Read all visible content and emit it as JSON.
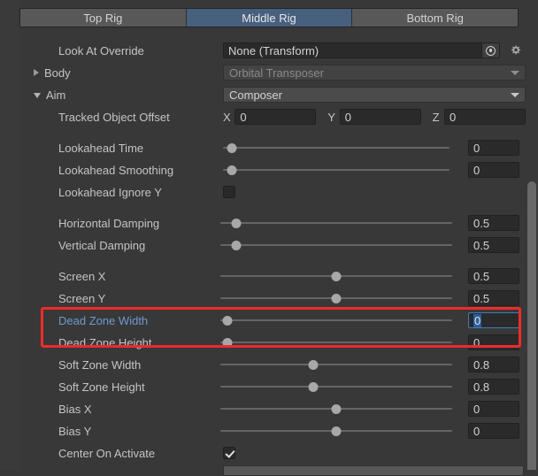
{
  "tabs": [
    {
      "label": "Top Rig",
      "active": false
    },
    {
      "label": "Middle Rig",
      "active": true
    },
    {
      "label": "Bottom Rig",
      "active": false
    }
  ],
  "accent_selected_tab": "#46607e",
  "accent_focus_label": "#6e9ad0",
  "accent_highlight_box": "#ee2b2b",
  "rows": {
    "look_at_override": {
      "label": "Look At Override",
      "value": "None (Transform)",
      "picker_icon": "object-picker-icon",
      "gear_icon": "gear-icon"
    },
    "body": {
      "label": "Body",
      "foldout": "collapsed",
      "value": "Orbital Transposer"
    },
    "aim": {
      "label": "Aim",
      "foldout": "expanded",
      "value": "Composer"
    },
    "tracked_object_offset": {
      "label": "Tracked Object Offset",
      "x_label": "X",
      "x_value": "0",
      "y_label": "Y",
      "y_value": "0",
      "z_label": "Z",
      "z_value": "0"
    },
    "lookahead_time": {
      "label": "Lookahead Time",
      "value": "0",
      "knob_pct": 0
    },
    "lookahead_smoothing": {
      "label": "Lookahead Smoothing",
      "value": "0",
      "knob_pct": 0
    },
    "lookahead_ignore_y": {
      "label": "Lookahead Ignore Y",
      "checked": false
    },
    "horizontal_damping": {
      "label": "Horizontal Damping",
      "value": "0.5",
      "knob_pct": 3
    },
    "vertical_damping": {
      "label": "Vertical Damping",
      "value": "0.5",
      "knob_pct": 3
    },
    "screen_x": {
      "label": "Screen X",
      "value": "0.5",
      "knob_pct": 50
    },
    "screen_y": {
      "label": "Screen Y",
      "value": "0.5",
      "knob_pct": 50
    },
    "dead_zone_width": {
      "label": "Dead Zone Width",
      "value": "0",
      "knob_pct": 0,
      "focused": true
    },
    "dead_zone_height": {
      "label": "Dead Zone Height",
      "value": "0",
      "knob_pct": 0
    },
    "soft_zone_width": {
      "label": "Soft Zone Width",
      "value": "0.8",
      "knob_pct": 40
    },
    "soft_zone_height": {
      "label": "Soft Zone Height",
      "value": "0.8",
      "knob_pct": 40
    },
    "bias_x": {
      "label": "Bias X",
      "value": "0",
      "knob_pct": 50
    },
    "bias_y": {
      "label": "Bias Y",
      "value": "0",
      "knob_pct": 50
    },
    "center_on_activate": {
      "label": "Center On Activate",
      "checked": true
    }
  }
}
